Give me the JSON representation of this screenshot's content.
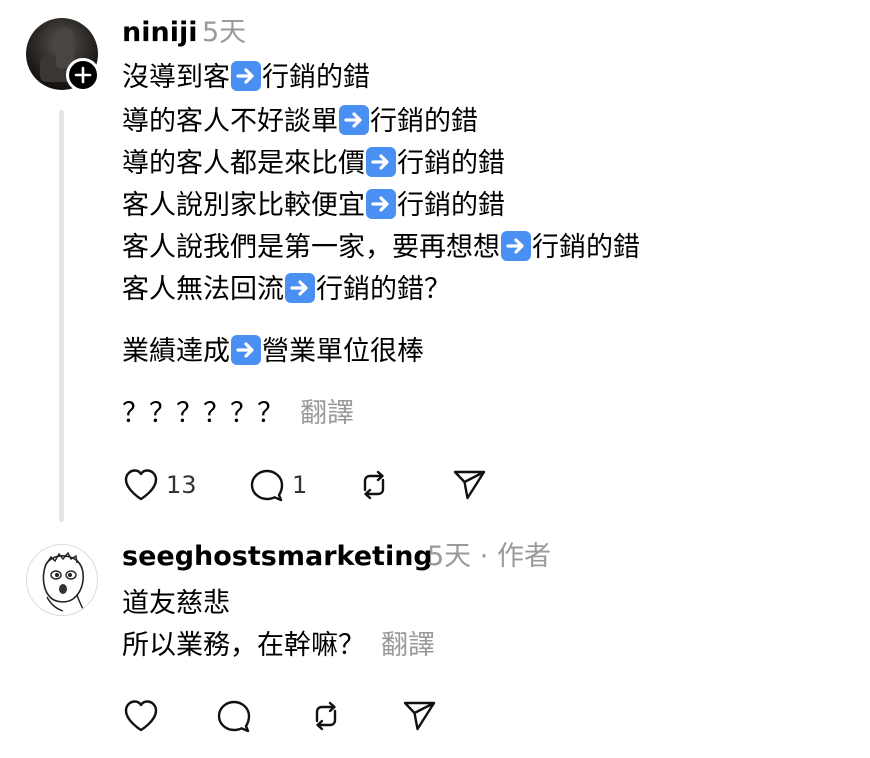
{
  "post1": {
    "username": "niniji",
    "time": "5天",
    "lines": [
      {
        "before": "沒導到客",
        "after": "行銷的錯"
      },
      {
        "before": "導的客人不好談單",
        "after": "行銷的錯"
      },
      {
        "before": "導的客人都是來比價",
        "after": "行銷的錯"
      },
      {
        "before": "客人說別家比較便宜",
        "after": "行銷的錯"
      },
      {
        "before": "客人說我們是第一家，要再想想",
        "after": "行銷的錯"
      },
      {
        "before": "客人無法回流",
        "after": "行銷的錯？"
      }
    ],
    "line7": {
      "before": "業績達成",
      "after": "營業單位很棒"
    },
    "line8": "？？？？？？",
    "translate_label": "翻譯",
    "like_count": "13",
    "reply_count": "1"
  },
  "post2": {
    "username": "seeghostsmarketing",
    "time": "5天",
    "separator": "·",
    "author_badge": "作者",
    "line1": "道友慈悲",
    "line2": "所以業務，在幹嘛？",
    "translate_label": "翻譯"
  },
  "icons": {
    "emoji": "right-arrow-emoji",
    "like": "heart-icon",
    "reply": "comment-icon",
    "repost": "repost-icon",
    "share": "send-icon",
    "follow": "plus-icon"
  },
  "colors": {
    "text": "#000000",
    "muted": "#9a9a9a",
    "emoji_blue": "#4a8ff2",
    "thread_line": "#e6e6e6"
  }
}
